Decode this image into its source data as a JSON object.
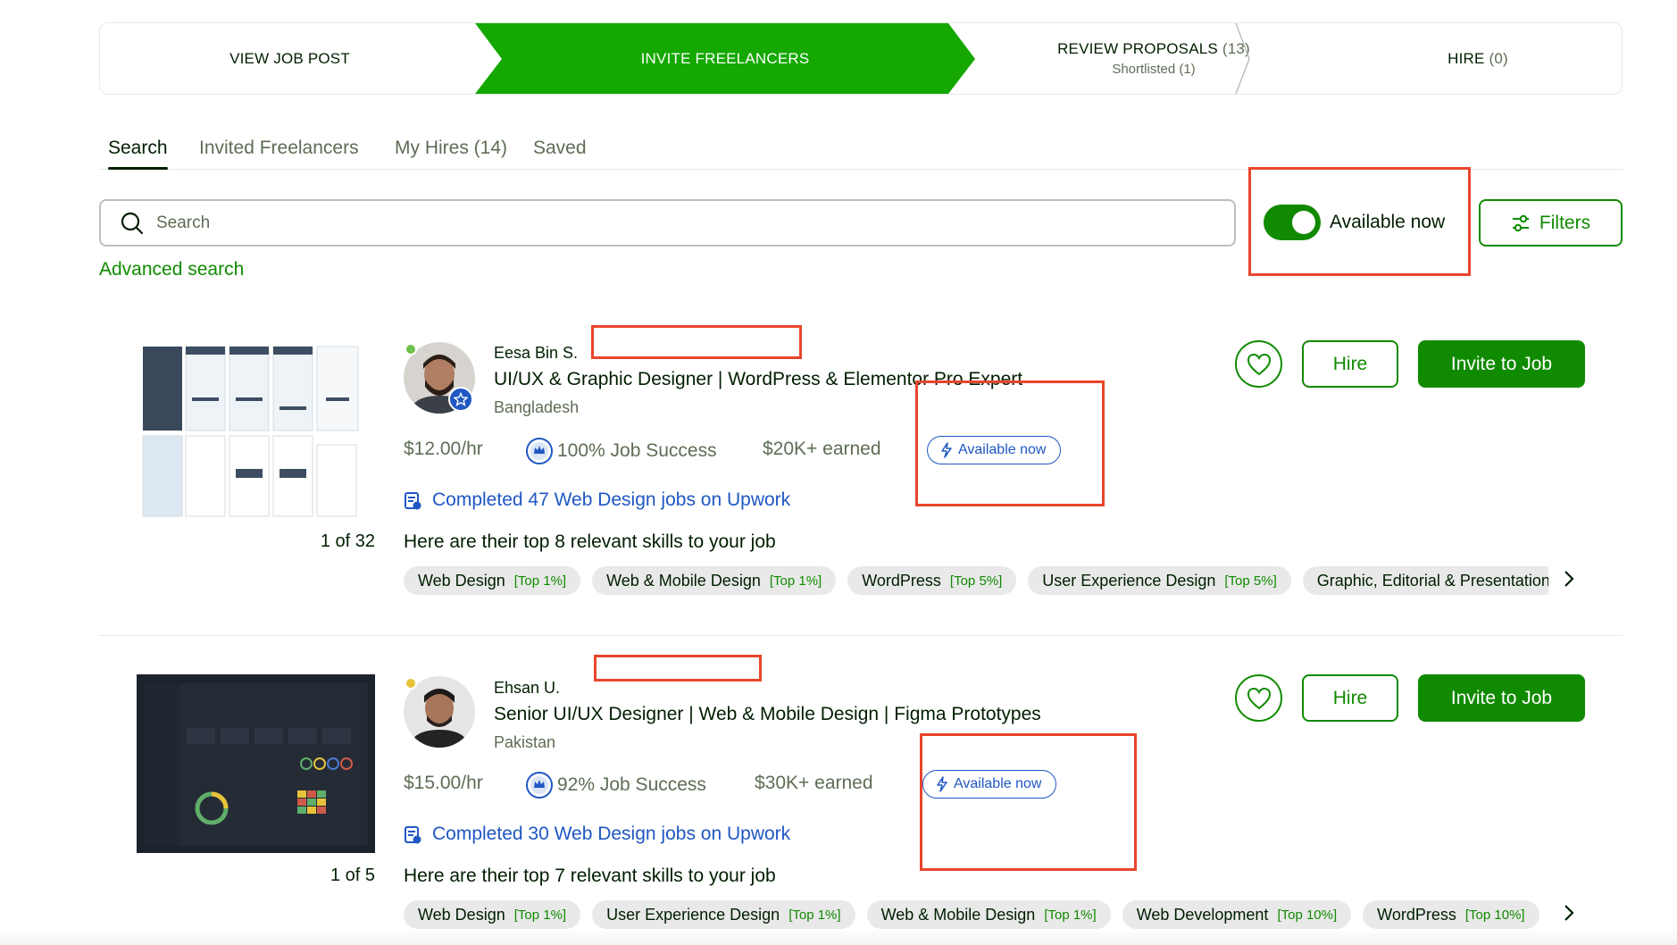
{
  "stepper": {
    "view_job_post": "VIEW JOB POST",
    "invite_freelancers": "INVITE FREELANCERS",
    "review_proposals": "REVIEW PROPOSALS",
    "review_count": "(13)",
    "shortlisted": "Shortlisted (1)",
    "hire": "HIRE",
    "hire_count": "(0)"
  },
  "tabs": [
    "Search",
    "Invited Freelancers",
    "My Hires (14)",
    "Saved"
  ],
  "search": {
    "placeholder": "Search",
    "advanced_label": "Advanced search"
  },
  "available_toggle": {
    "label": "Available now",
    "on": true
  },
  "filters_label": "Filters",
  "freelancers": [
    {
      "name": "Eesa Bin S.",
      "title": "UI/UX & Graphic Designer | WordPress & Elementor Pro Expert",
      "country": "Bangladesh",
      "rate": "$12.00/hr",
      "job_success": "100% Job Success",
      "earned": "$20K+ earned",
      "availability": "Available now",
      "completed": "Completed 47 Web Design jobs on Upwork",
      "skills_heading": "Here are their top 8 relevant skills to your job",
      "portfolio_pager": "1 of 32",
      "status_color": "#6dc24b",
      "skills": [
        {
          "name": "Web Design",
          "rank": "[Top 1%]"
        },
        {
          "name": "Web & Mobile Design",
          "rank": "[Top 1%]"
        },
        {
          "name": "WordPress",
          "rank": "[Top 5%]"
        },
        {
          "name": "User Experience Design",
          "rank": "[Top 5%]"
        },
        {
          "name": "Graphic, Editorial & Presentation Design",
          "rank": ""
        }
      ],
      "buttons": {
        "hire": "Hire",
        "invite": "Invite to Job"
      }
    },
    {
      "name": "Ehsan U.",
      "title": "Senior UI/UX Designer | Web & Mobile Design | Figma Prototypes",
      "country": "Pakistan",
      "rate": "$15.00/hr",
      "job_success": "92% Job Success",
      "earned": "$30K+ earned",
      "availability": "Available now",
      "completed": "Completed 30 Web Design jobs on Upwork",
      "skills_heading": "Here are their top 7 relevant skills to your job",
      "portfolio_pager": "1 of 5",
      "status_color": "#e8c33a",
      "skills": [
        {
          "name": "Web Design",
          "rank": "[Top 1%]"
        },
        {
          "name": "User Experience Design",
          "rank": "[Top 1%]"
        },
        {
          "name": "Web & Mobile Design",
          "rank": "[Top 1%]"
        },
        {
          "name": "Web Development",
          "rank": "[Top 10%]"
        },
        {
          "name": "WordPress",
          "rank": "[Top 10%]"
        }
      ],
      "buttons": {
        "hire": "Hire",
        "invite": "Invite to Job"
      }
    }
  ],
  "colors": {
    "brand_green": "#108a00",
    "link_blue": "#1f57c3",
    "annotation_red": "#e8452c"
  }
}
